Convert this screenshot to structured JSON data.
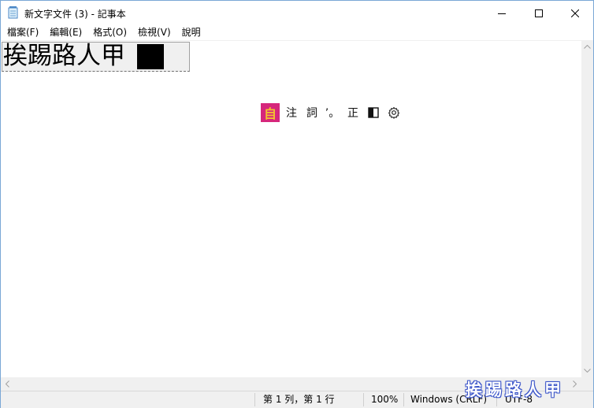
{
  "window": {
    "title": "新文字文件 (3) - 記事本",
    "icon": "notepad-icon"
  },
  "menu": {
    "items": [
      {
        "label": "檔案(F)"
      },
      {
        "label": "編輯(E)"
      },
      {
        "label": "格式(O)"
      },
      {
        "label": "檢視(V)"
      },
      {
        "label": "說明"
      }
    ]
  },
  "editor": {
    "composition_text": "挨踢路人甲"
  },
  "ime_toolbar": {
    "mode_label": "自",
    "buttons": [
      {
        "label": "注"
      },
      {
        "label": "詞"
      },
      {
        "label": "’。"
      },
      {
        "label": "正"
      }
    ],
    "colors": {
      "mode_bg": "#d6277b",
      "mode_fg": "#f2c230"
    }
  },
  "statusbar": {
    "position": "第 1 列，第 1 行",
    "zoom": "100%",
    "line_ending": "Windows (CRLF)",
    "encoding": "UTF-8"
  },
  "watermark": {
    "text": "挨踢路人甲"
  }
}
